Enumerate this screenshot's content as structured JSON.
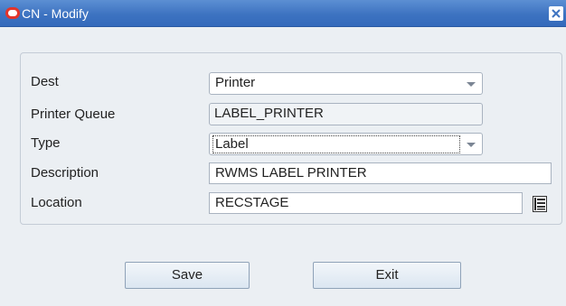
{
  "window": {
    "title": "CN - Modify",
    "icons": {
      "app": "oracle-ring-icon",
      "close": "close-icon"
    }
  },
  "form": {
    "dest": {
      "label": "Dest",
      "value": "Printer"
    },
    "printer_queue": {
      "label": "Printer Queue",
      "value": "LABEL_PRINTER"
    },
    "type": {
      "label": "Type",
      "value": "Label"
    },
    "description": {
      "label": "Description",
      "value": "RWMS LABEL PRINTER"
    },
    "location": {
      "label": "Location",
      "value": "RECSTAGE",
      "lov_icon": "list-of-values-icon"
    }
  },
  "buttons": {
    "save": "Save",
    "exit": "Exit"
  },
  "colors": {
    "titlebar": "#3d73c1",
    "body": "#ebeff3",
    "oracle_red": "#e3342a",
    "button": "#dbe6f1"
  }
}
